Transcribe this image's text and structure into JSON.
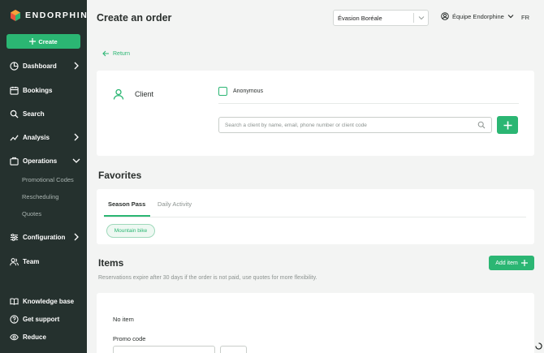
{
  "sidebar": {
    "logo": "ENDORPHINE",
    "create_label": "Create",
    "items": [
      {
        "label": "Dashboard"
      },
      {
        "label": "Bookings"
      },
      {
        "label": "Search"
      },
      {
        "label": "Analysis"
      },
      {
        "label": "Operations"
      },
      {
        "label": "Configuration"
      },
      {
        "label": "Team"
      }
    ],
    "operations_sub": [
      "Promotional Codes",
      "Rescheduling",
      "Quotes"
    ],
    "bottom": [
      "Knowledge base",
      "Get support",
      "Reduce"
    ]
  },
  "header": {
    "title": "Create an order",
    "org_value": "Évasion Boréale",
    "team_label": "Équipe Endorphine",
    "lang": "FR"
  },
  "return_label": "Return",
  "client": {
    "label": "Client",
    "anonymous_label": "Anonymous",
    "search_placeholder": "Search a client by name, email, phone number or client code"
  },
  "favorites": {
    "title": "Favorites",
    "tabs": [
      "Season Pass",
      "Daily Activity"
    ],
    "chips": [
      "Mountain bike"
    ]
  },
  "items": {
    "title": "Items",
    "add_label": "Add item",
    "note": "Reservations expire after 30 days if the order is not paid, use quotes for more flexibility.",
    "empty_label": "No item",
    "promo_label": "Promo code"
  },
  "colors": {
    "accent": "#2bb673",
    "sidebar_bg": "#25312e",
    "page_bg": "#f3f4f3"
  }
}
